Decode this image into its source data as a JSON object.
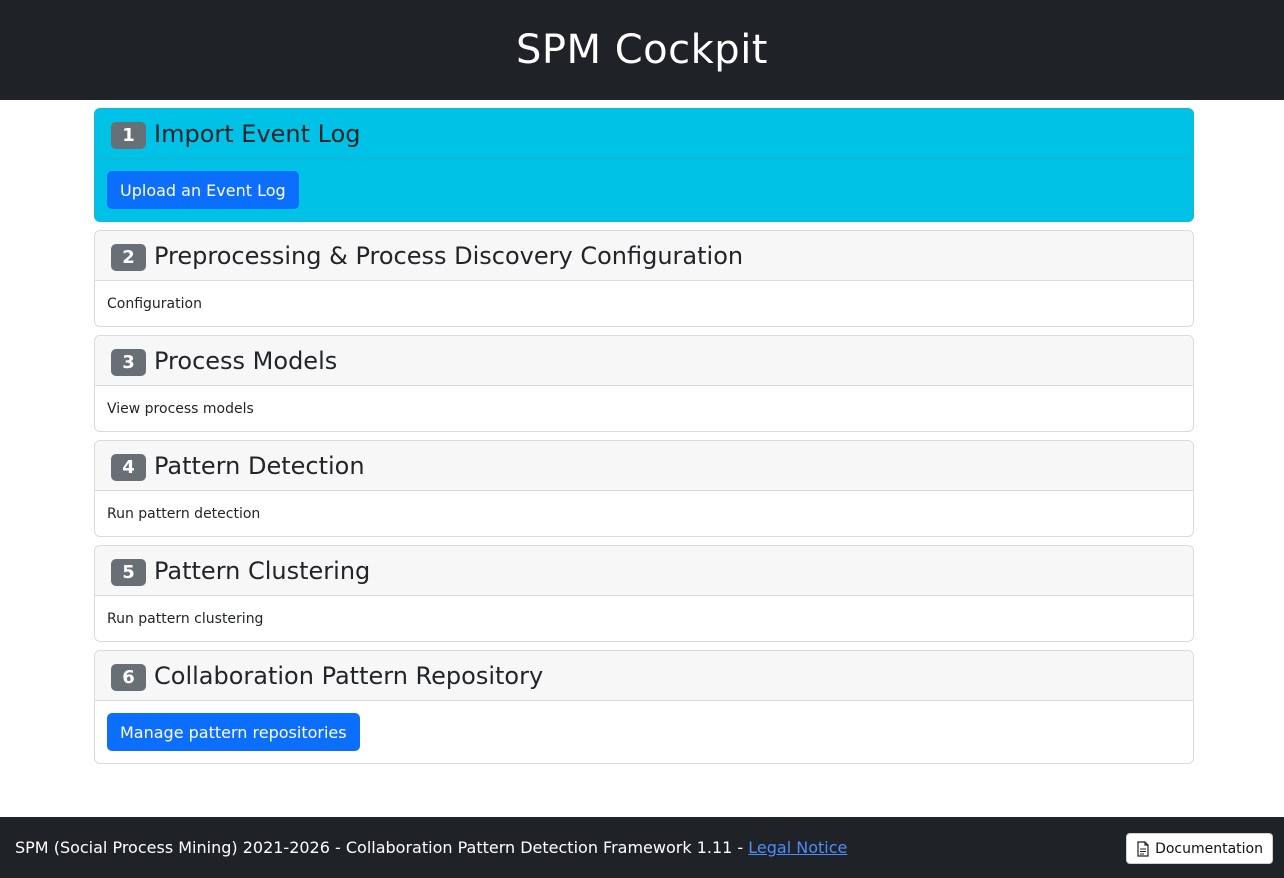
{
  "header": {
    "title": "SPM Cockpit"
  },
  "steps": [
    {
      "number": "1",
      "title": "Import Event Log",
      "action": "Upload an Event Log",
      "action_type": "button"
    },
    {
      "number": "2",
      "title": "Preprocessing & Process Discovery Configuration",
      "action": "Configuration",
      "action_type": "text"
    },
    {
      "number": "3",
      "title": "Process Models",
      "action": "View process models",
      "action_type": "text"
    },
    {
      "number": "4",
      "title": "Pattern Detection",
      "action": "Run pattern detection",
      "action_type": "text"
    },
    {
      "number": "5",
      "title": "Pattern Clustering",
      "action": "Run pattern clustering",
      "action_type": "text"
    },
    {
      "number": "6",
      "title": "Collaboration Pattern Repository",
      "action": "Manage pattern repositories",
      "action_type": "button"
    }
  ],
  "footer": {
    "text": "SPM (Social Process Mining) 2021-2026 - Collaboration Pattern Detection Framework 1.11 - ",
    "legal_link": "Legal Notice",
    "documentation_label": "Documentation",
    "documentation_icon": "document-icon"
  },
  "colors": {
    "header_bg": "#1f2327",
    "active_card_bg": "#00c2e6",
    "primary_button": "#0b6efd",
    "badge_bg": "#686f76"
  }
}
